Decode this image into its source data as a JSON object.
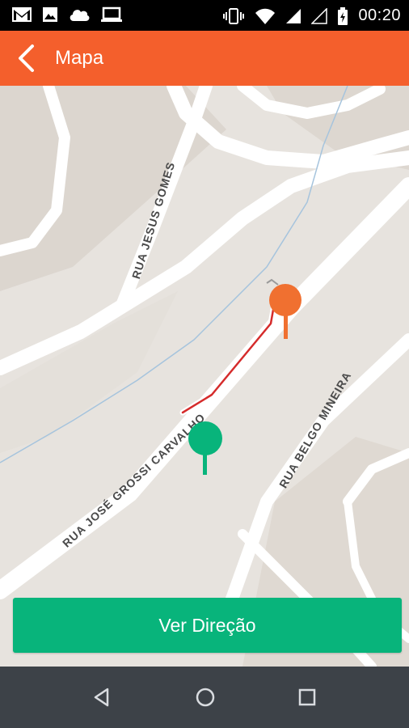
{
  "status_bar": {
    "left_icons": [
      "gmail-icon",
      "image-icon",
      "cloud-icon",
      "laptop-icon"
    ],
    "right_icons": [
      "vibrate-icon",
      "wifi-icon",
      "signal-icon",
      "signal-empty-icon",
      "battery-icon"
    ],
    "time": "00:20"
  },
  "app_bar": {
    "title": "Mapa",
    "background": "#f45f2c"
  },
  "map": {
    "streets": [
      {
        "label": "RUA JESUS GOMES"
      },
      {
        "label": "RUA JOSÉ GROSSI CARVALHO"
      },
      {
        "label": "RUA BELGO MINEIRA"
      }
    ],
    "markers": [
      {
        "name": "origin",
        "color": "#f07030"
      },
      {
        "name": "destination",
        "color": "#08b47b"
      }
    ],
    "route_color": "#d52b2b"
  },
  "action": {
    "label": "Ver Direção",
    "color": "#08b47b"
  },
  "nav_bar": {
    "buttons": [
      "back-icon",
      "home-icon",
      "recents-icon"
    ]
  }
}
